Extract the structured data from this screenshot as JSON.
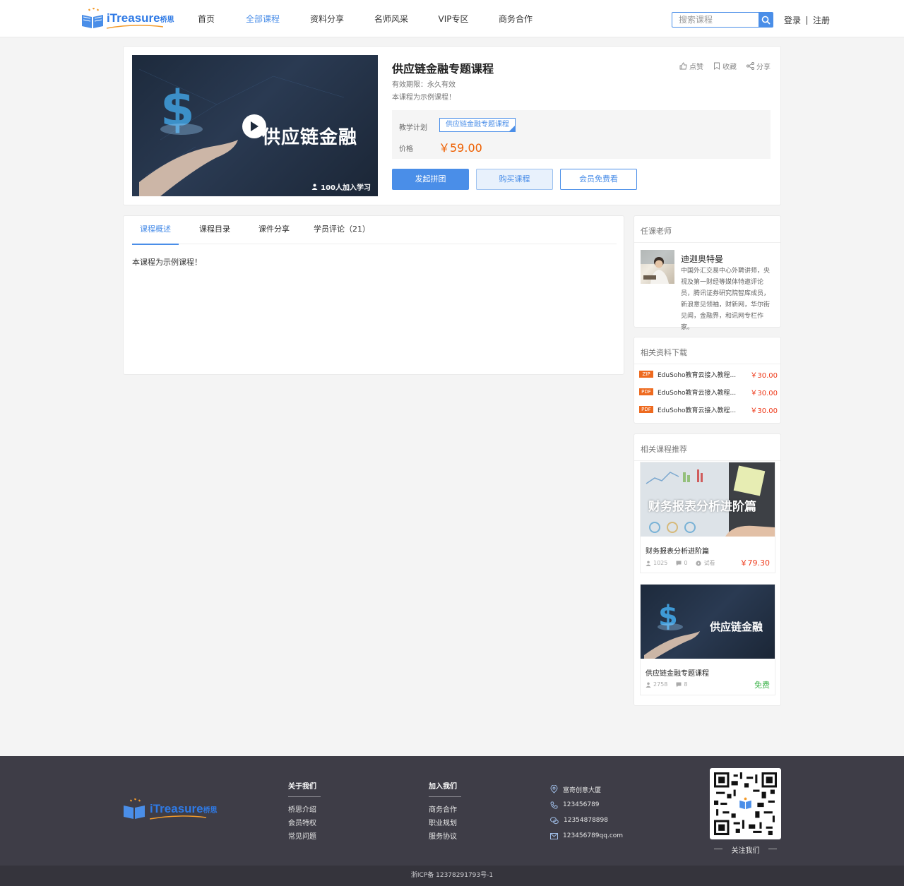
{
  "header": {
    "logo_text": "iTreasure",
    "logo_sub": "桥思",
    "nav": [
      {
        "label": "首页"
      },
      {
        "label": "全部课程"
      },
      {
        "label": "资料分享"
      },
      {
        "label": "名师风采"
      },
      {
        "label": "VIP专区"
      },
      {
        "label": "商务合作"
      }
    ],
    "search_placeholder": "搜索课程",
    "login": "登录",
    "register": "注册"
  },
  "course": {
    "cover_text": "供应链金融",
    "learners": "100人加入学习",
    "title": "供应链金融专题课程",
    "validity": "有效期限：永久有效",
    "desc": "本课程为示例课程！",
    "actions": {
      "like": "点赞",
      "fav": "收藏",
      "share": "分享"
    },
    "plan_label": "教学计划",
    "plan_value": "供应链金融专题课程",
    "price_label": "价格",
    "price": "￥59.00",
    "btn_group": "发起拼团",
    "btn_buy": "购买课程",
    "btn_vip": "会员免费看"
  },
  "tabs": [
    {
      "label": "课程概述"
    },
    {
      "label": "课程目录"
    },
    {
      "label": "课件分享"
    },
    {
      "label": "学员评论（21）"
    }
  ],
  "main_body": "本课程为示例课程！",
  "teacher": {
    "heading": "任课老师",
    "name": "迪迦奥特曼",
    "desc": "中国外汇交易中心外聘讲师，央视及第一财经等媒体特邀评论员，腾讯证券研究院智库成员，新浪意见领袖，财新网，华尔街见闻，金融界，和讯网专栏作家。"
  },
  "downloads": {
    "heading": "相关资料下载",
    "items": [
      {
        "type": "ZIP",
        "name": "EduSoho教育云接入教程...",
        "price": "￥30.00"
      },
      {
        "type": "PDF",
        "name": "EduSoho教育云接入教程...",
        "price": "￥30.00"
      },
      {
        "type": "PDF",
        "name": "EduSoho教育云接入教程...",
        "price": "￥30.00"
      }
    ]
  },
  "recommend": {
    "heading": "相关课程推荐",
    "items": [
      {
        "img_text": "财务报表分析进阶篇",
        "title": "财务报表分析进阶篇",
        "students": "1025",
        "comments": "0",
        "trial": "试看",
        "price": "￥79.30",
        "price_color": "#ee3a1a"
      },
      {
        "img_text": "供应链金融",
        "title": "供应链金融专题课程",
        "students": "2758",
        "comments": "8",
        "price": "免费",
        "price_color": "#3cb34a"
      }
    ]
  },
  "footer": {
    "col1": {
      "title": "关于我们",
      "items": [
        "桥思介绍",
        "会员特权",
        "常见问题"
      ]
    },
    "col2": {
      "title": "加入我们",
      "items": [
        "商务合作",
        "职业规划",
        "服务协议"
      ]
    },
    "contact": {
      "address": "富奇创意大厦",
      "phone": "123456789",
      "wechat": "12354878898",
      "email": "123456789qq.com"
    },
    "qr_caption": "关注我们",
    "icp": "浙ICP备 12378291793号-1"
  },
  "colors": {
    "accent": "#4a8ee8",
    "price": "#ee5f00",
    "footer_bg": "#3e3d47"
  }
}
